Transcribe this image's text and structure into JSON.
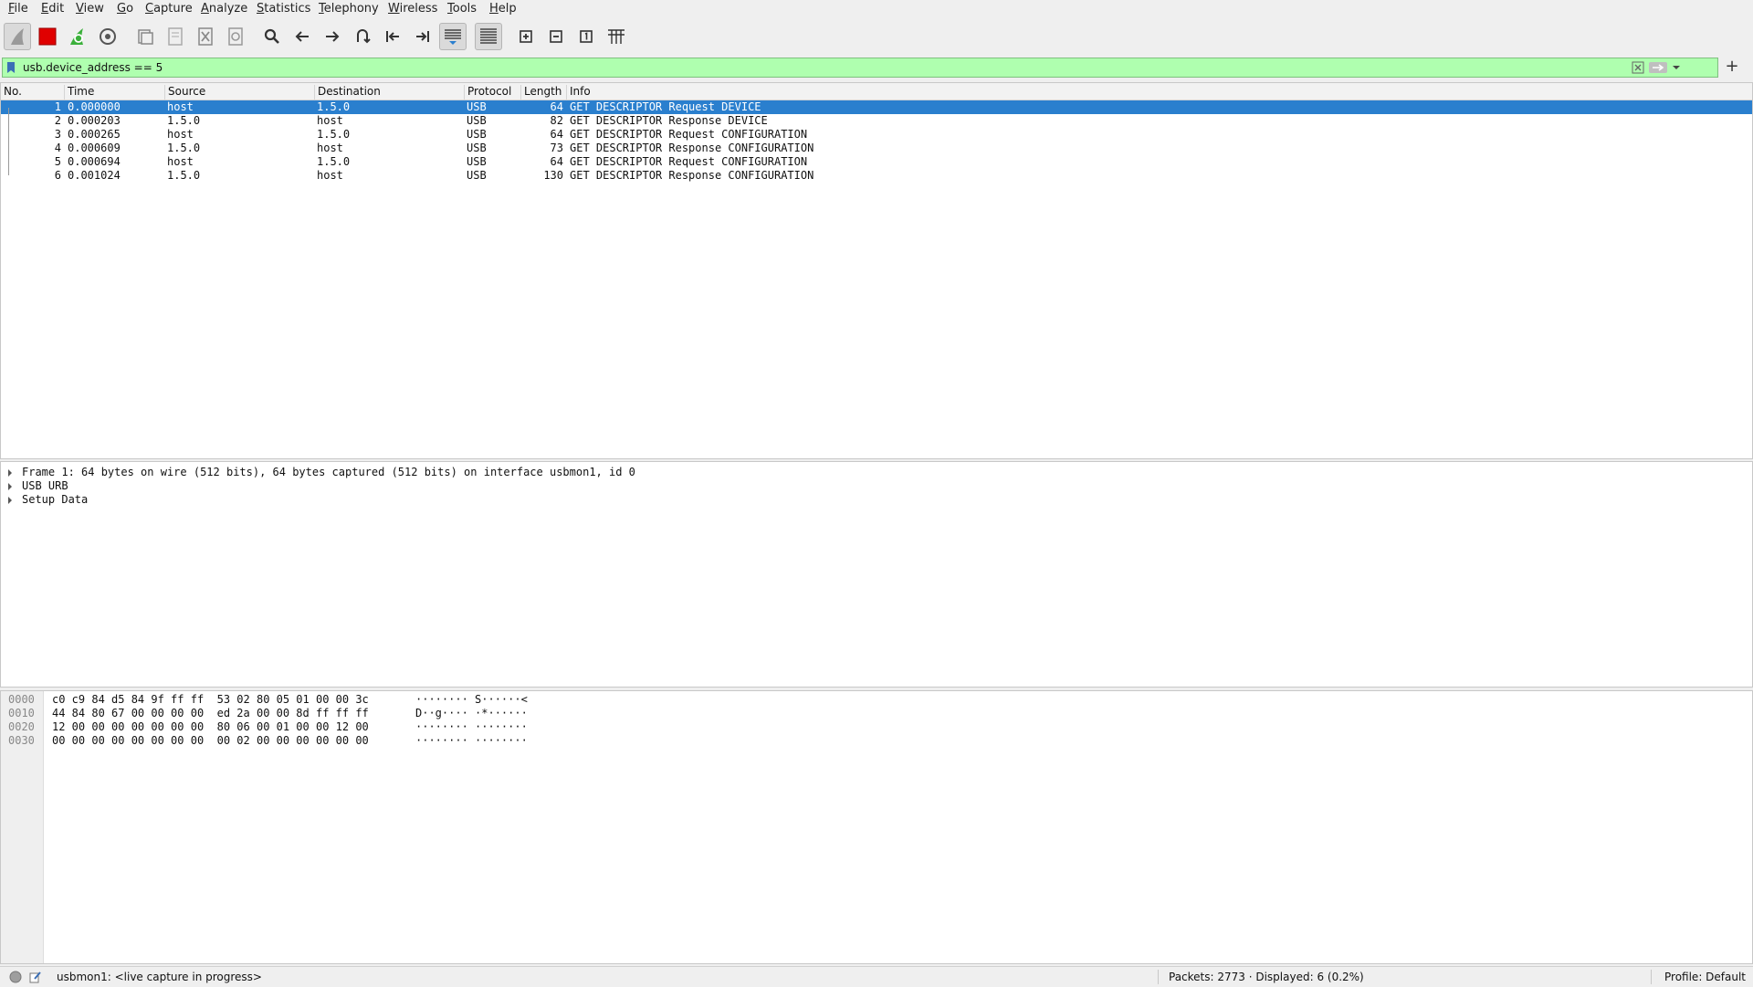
{
  "menu": [
    "File",
    "Edit",
    "View",
    "Go",
    "Capture",
    "Analyze",
    "Statistics",
    "Telephony",
    "Wireless",
    "Tools",
    "Help"
  ],
  "toolbar": {
    "icons": [
      "shark-fin-start-icon",
      "stop-capture-icon",
      "restart-capture-icon",
      "capture-options-icon",
      "open-file-icon",
      "save-file-icon",
      "close-file-icon",
      "reload-file-icon",
      "find-packet-icon",
      "go-back-icon",
      "go-forward-icon",
      "go-to-packet-icon",
      "first-packet-icon",
      "last-packet-icon",
      "auto-scroll-icon",
      "colorize-icon",
      "zoom-in-icon",
      "zoom-out-icon",
      "normal-size-icon",
      "resize-columns-icon"
    ]
  },
  "filter": {
    "text": "usb.device_address == 5"
  },
  "packet_list": {
    "columns": [
      "No.",
      "Time",
      "Source",
      "Destination",
      "Protocol",
      "Length",
      "Info"
    ],
    "rows": [
      {
        "no": "1",
        "time": "0.000000",
        "src": "host",
        "dst": "1.5.0",
        "proto": "USB",
        "len": "64",
        "info": "GET DESCRIPTOR Request DEVICE",
        "selected": true
      },
      {
        "no": "2",
        "time": "0.000203",
        "src": "1.5.0",
        "dst": "host",
        "proto": "USB",
        "len": "82",
        "info": "GET DESCRIPTOR Response DEVICE",
        "selected": false
      },
      {
        "no": "3",
        "time": "0.000265",
        "src": "host",
        "dst": "1.5.0",
        "proto": "USB",
        "len": "64",
        "info": "GET DESCRIPTOR Request CONFIGURATION",
        "selected": false
      },
      {
        "no": "4",
        "time": "0.000609",
        "src": "1.5.0",
        "dst": "host",
        "proto": "USB",
        "len": "73",
        "info": "GET DESCRIPTOR Response CONFIGURATION",
        "selected": false
      },
      {
        "no": "5",
        "time": "0.000694",
        "src": "host",
        "dst": "1.5.0",
        "proto": "USB",
        "len": "64",
        "info": "GET DESCRIPTOR Request CONFIGURATION",
        "selected": false
      },
      {
        "no": "6",
        "time": "0.001024",
        "src": "1.5.0",
        "dst": "host",
        "proto": "USB",
        "len": "130",
        "info": "GET DESCRIPTOR Response CONFIGURATION",
        "selected": false
      }
    ]
  },
  "details": [
    "Frame 1: 64 bytes on wire (512 bits), 64 bytes captured (512 bits) on interface usbmon1, id 0",
    "USB URB",
    "Setup Data"
  ],
  "bytes": [
    {
      "off": "0000",
      "hex": "c0 c9 84 d5 84 9f ff ff  53 02 80 05 01 00 00 3c",
      "asc": "········ S······<"
    },
    {
      "off": "0010",
      "hex": "44 84 80 67 00 00 00 00  ed 2a 00 00 8d ff ff ff",
      "asc": "D··g···· ·*······"
    },
    {
      "off": "0020",
      "hex": "12 00 00 00 00 00 00 00  80 06 00 01 00 00 12 00",
      "asc": "········ ········"
    },
    {
      "off": "0030",
      "hex": "00 00 00 00 00 00 00 00  00 02 00 00 00 00 00 00",
      "asc": "········ ········"
    }
  ],
  "status": {
    "capture": "usbmon1: <live capture in progress>",
    "packets": "Packets: 2773 · Displayed: 6 (0.2%)",
    "profile": "Profile: Default"
  },
  "colors": {
    "selected_row": "#2a7fce",
    "filter_ok": "#afffaf",
    "stop_red": "#e00000"
  }
}
